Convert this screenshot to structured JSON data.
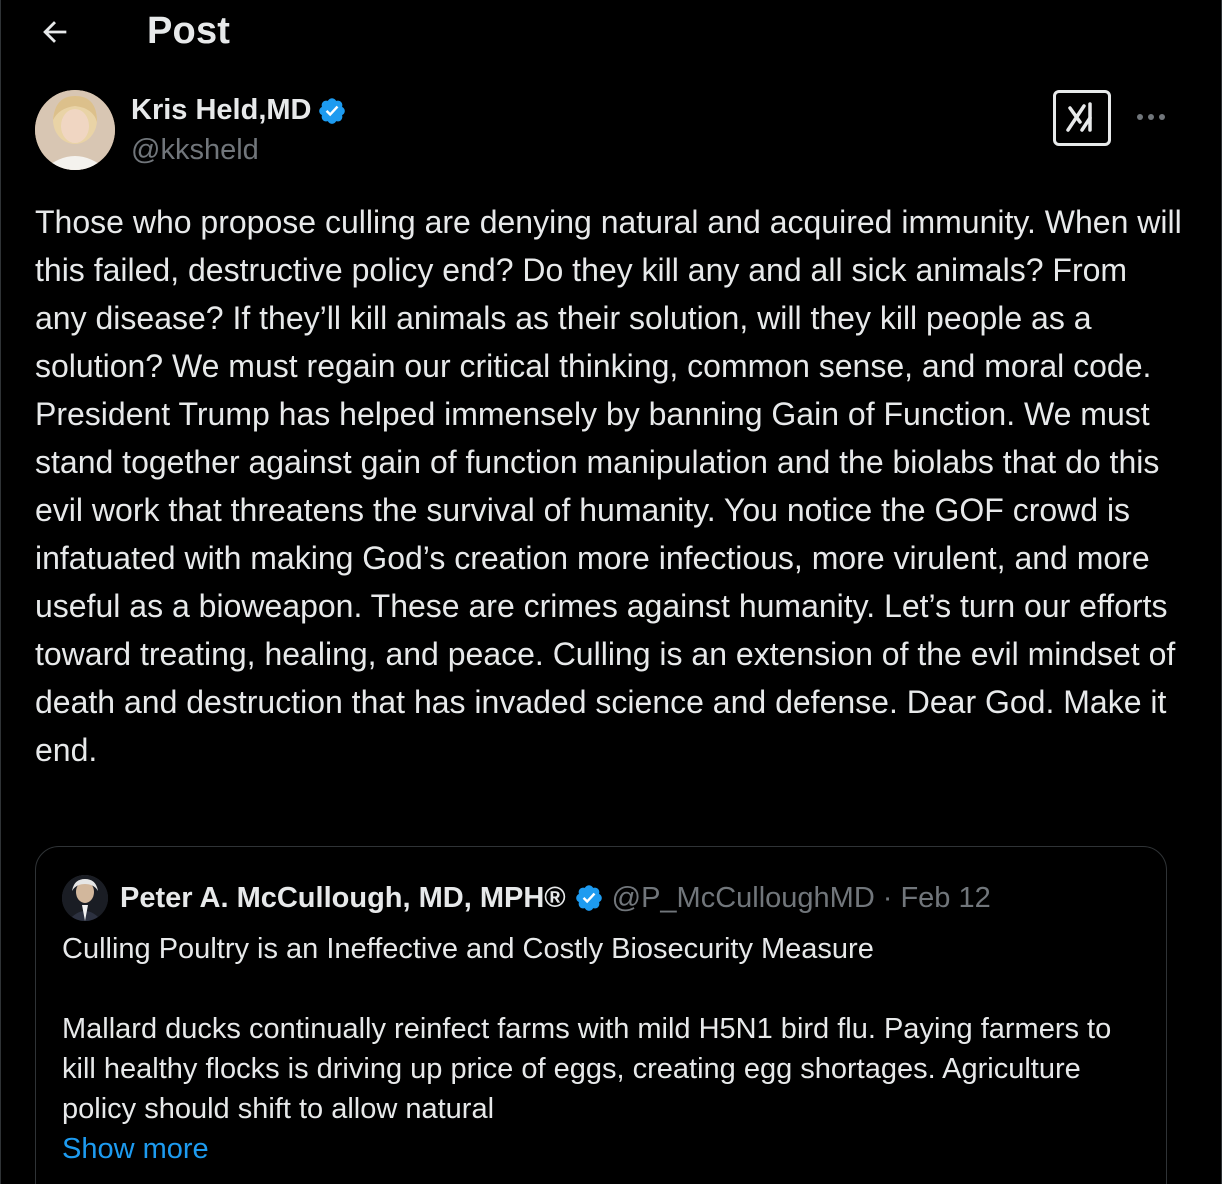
{
  "header": {
    "title": "Post"
  },
  "author": {
    "name": "Kris Held,MD",
    "handle": "@kksheld",
    "verified": true
  },
  "post": {
    "text": "Those who propose culling  are denying natural and acquired immunity. When will this failed, destructive policy end? Do they kill any and all sick animals? From any disease? If they’ll kill animals as their solution, will they kill people as a solution? We must regain our critical thinking, common sense, and moral code. President Trump has helped immensely by banning Gain of Function. We must stand together against gain of function manipulation and the biolabs that do this evil work that threatens the survival of humanity. You notice the GOF crowd is infatuated with making God’s creation more infectious, more virulent, and more useful as a bioweapon. These are crimes against humanity. Let’s turn our efforts toward treating, healing, and peace. Culling is an extension of the evil mindset of death and destruction that has invaded science and defense. Dear God. Make it end."
  },
  "quote": {
    "name": "Peter A. McCullough, MD, MPH®",
    "handle": "@P_McCulloughMD",
    "separator": "·",
    "date": "Feb 12",
    "title": "Culling Poultry is an Ineffective and Costly Biosecurity Measure",
    "body": "Mallard ducks continually reinfect farms with mild H5N1 bird flu.  Paying farmers to kill healthy flocks is driving up price of eggs, creating egg shortages. Agriculture policy should shift to allow natural",
    "show_more": "Show more"
  },
  "icons": {
    "back": "arrow-left-icon",
    "verified": "verified-badge-icon",
    "grok": "grok-icon",
    "more": "more-horizontal-icon"
  },
  "colors": {
    "background": "#000000",
    "text": "#e7e9ea",
    "secondary_text": "#71767b",
    "accent": "#1d9bf0",
    "border": "#2f3336"
  }
}
